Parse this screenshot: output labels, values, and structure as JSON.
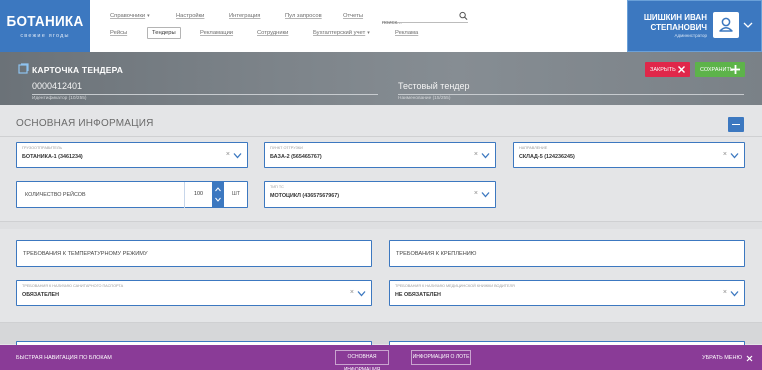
{
  "brand": {
    "name": "БОТАНИКА",
    "tagline": "свежие ягоды"
  },
  "nav": {
    "row1": [
      "Справочники",
      "Настройки",
      "Интеграция",
      "Пул запросов",
      "Отчеты"
    ],
    "row2": [
      "Рейсы",
      "Тендеры",
      "Рекламации",
      "Сотрудники",
      "Бухгалтерский учет",
      "Реклама"
    ],
    "active": "Тендеры"
  },
  "search": {
    "placeholder": "поиск..."
  },
  "user": {
    "name_line1": "ШИШКИН ИВАН",
    "name_line2": "СТЕПАНОВИЧ",
    "role": "Администратор"
  },
  "header": {
    "title": "КАРТОЧКА ТЕНДЕРА",
    "id_value": "0000412401",
    "id_label": "Идентификатор (10/255)",
    "name_value": "Тестовый тендер",
    "name_label": "Наименование (15/255)",
    "close_label": "ЗАКРЫТЬ",
    "save_label": "СОХРАНИТЬ"
  },
  "section": {
    "title": "ОСНОВНАЯ ИНФОРМАЦИЯ"
  },
  "fields": {
    "shipper": {
      "label": "Грузоотправитель",
      "value": "БОТАНИКА-1 (3461234)"
    },
    "shipment_place": {
      "label": "Пункт отгрузки",
      "value": "БАЗА-2 (565465767)"
    },
    "direction": {
      "label": "Направление",
      "value": "СКЛАД-5 (124236245)"
    },
    "trips": {
      "label": "КОЛИЧЕСТВО РЕЙСОВ",
      "value": "100",
      "unit": "ШТ"
    },
    "vehicle_type": {
      "label": "Тип ТС",
      "value": "МОТОЦИКЛ (43657567967)"
    },
    "temp_req": {
      "label": "ТРЕБОВАНИЯ К ТЕМПЕРАТУРНОМУ РЕЖИМУ"
    },
    "fastening_req": {
      "label": "ТРЕБОВАНИЯ К КРЕПЛЕНИЮ"
    },
    "sanitary": {
      "label": "Требования к наличию санитарного паспорта",
      "value": "ОБЯЗАТЕЛЕН"
    },
    "medical": {
      "label": "Требования к наличию медицинской книжки водителя",
      "value": "НЕ ОБЯЗАТЕЛЕН"
    }
  },
  "footer": {
    "title": "БЫСТРАЯ НАВИГАЦИЯ ПО БЛОКАМ",
    "buttons": [
      "ОСНОВНАЯ ИНФОРМАЦИЯ",
      "ИНФОРМАЦИЯ О ЛОТЕ"
    ],
    "hide_label": "УБРАТЬ МЕНЮ"
  },
  "colors": {
    "primary": "#3c78c0",
    "danger": "#e0274a",
    "success": "#5db34a",
    "footer": "#8a3b97"
  }
}
